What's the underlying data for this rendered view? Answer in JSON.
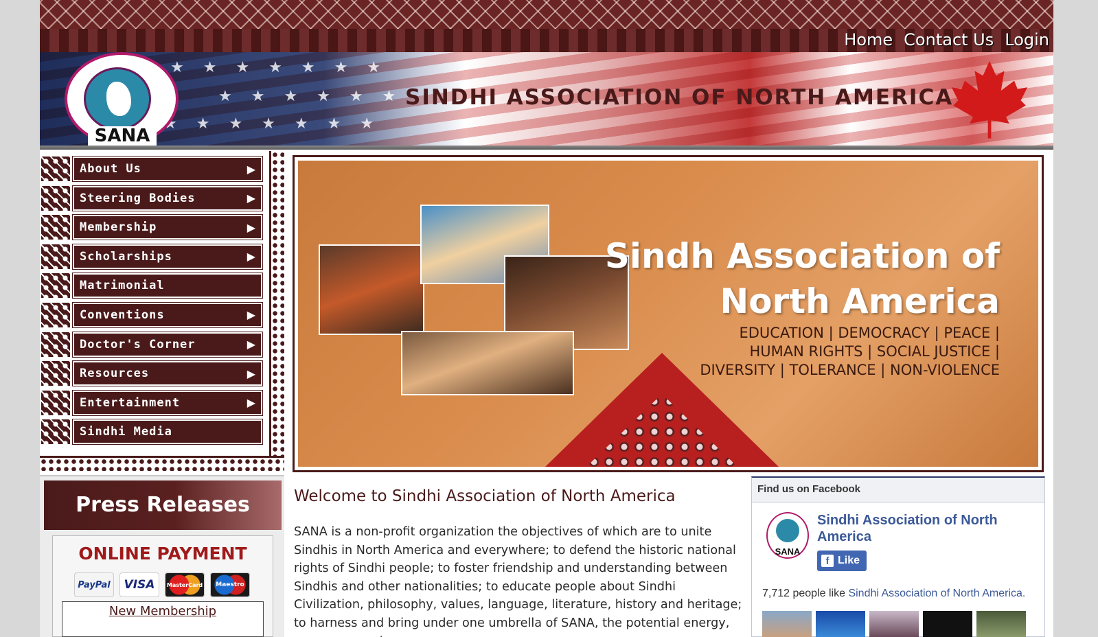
{
  "header": {
    "nav": [
      "Home",
      "Contact Us",
      "Login"
    ],
    "site_title": "SINDHI ASSOCIATION OF NORTH AMERICA",
    "logo_text": "SANA"
  },
  "menu": {
    "items": [
      {
        "label": "About Us",
        "has_submenu": true
      },
      {
        "label": "Steering Bodies",
        "has_submenu": true
      },
      {
        "label": "Membership",
        "has_submenu": true
      },
      {
        "label": "Scholarships",
        "has_submenu": true
      },
      {
        "label": "Matrimonial",
        "has_submenu": false
      },
      {
        "label": "Conventions",
        "has_submenu": true
      },
      {
        "label": "Doctor's Corner",
        "has_submenu": true
      },
      {
        "label": "Resources",
        "has_submenu": true
      },
      {
        "label": "Entertainment",
        "has_submenu": true
      },
      {
        "label": "Sindhi Media",
        "has_submenu": false
      }
    ]
  },
  "hero": {
    "title_line1": "Sindh Association of",
    "title_line2": "North America",
    "sub_line1": "EDUCATION | DEMOCRACY | PEACE |",
    "sub_line2": "HUMAN RIGHTS | SOCIAL JUSTICE |",
    "sub_line3": "DIVERSITY | TOLERANCE | NON-VIOLENCE"
  },
  "press": {
    "title": "Press Releases",
    "online_payment": "ONLINE PAYMENT",
    "cards": [
      "PayPal",
      "VISA",
      "MasterCard",
      "Maestro"
    ],
    "new_membership": "New Membership"
  },
  "welcome": {
    "title": "Welcome to Sindhi Association of North America",
    "text": "SANA is a non-profit organization the objectives of which are to unite Sindhis in North America and everywhere; to defend the historic national rights of Sindhi people; to foster friendship and understanding between Sindhis and other nationalities; to educate people about Sindhi Civilization, philosophy, values, language, literature, history and heritage; to harness and bring under one umbrella of SANA, the potential energy, resources, and"
  },
  "facebook": {
    "heading": "Find us on Facebook",
    "page_name": "Sindhi Association of North America",
    "logo_text": "SANA",
    "like_label": "Like",
    "count_text": "7,712 people like ",
    "count_link": "Sindhi Association of North America."
  },
  "colors": {
    "brand_maroon": "#4a1a1a",
    "facebook_blue": "#3b5998",
    "payment_red": "#a01a1a"
  }
}
